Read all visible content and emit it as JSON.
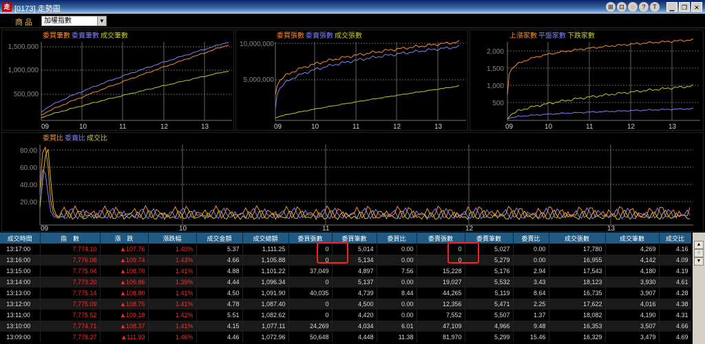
{
  "window": {
    "title": "[0173] 走勢圖",
    "app_icon": "app-logo-icon"
  },
  "title_tools": [
    "⊞",
    "⊡",
    "◌",
    "?",
    "T"
  ],
  "window_buttons": [
    "▁",
    "❐",
    "✕"
  ],
  "toolbar": {
    "product_label": "商 品",
    "product_value": "加權指數"
  },
  "charts": {
    "c1": {
      "legend": [
        "委買筆數",
        "委賣筆數",
        "成交筆數"
      ],
      "legend_colors": [
        "#ff8c28",
        "#8080ff",
        "#c8c828"
      ],
      "y_ticks": [
        "1,500,000",
        "1,000,000",
        "500,000"
      ],
      "x_ticks": [
        "09",
        "10",
        "11",
        "12",
        "13"
      ]
    },
    "c2": {
      "legend": [
        "委買張數",
        "委賣張數",
        "成交張數"
      ],
      "legend_colors": [
        "#ff8c28",
        "#8080ff",
        "#c8c828"
      ],
      "y_ticks": [
        "10,000,000",
        "5,000,000"
      ],
      "x_ticks": [
        "09",
        "10",
        "11",
        "12",
        "13"
      ]
    },
    "c3": {
      "legend": [
        "上漲家數",
        "平盤家數",
        "下跌家數"
      ],
      "legend_colors": [
        "#ff8c28",
        "#8080ff",
        "#c8c828"
      ],
      "y_ticks": [
        "2,000",
        "1,500",
        "1,000",
        "500"
      ],
      "x_ticks": [
        "09",
        "10",
        "11",
        "12",
        "13"
      ]
    },
    "c4": {
      "legend": [
        "委買比",
        "委賣比",
        "成交比"
      ],
      "legend_colors": [
        "#ff8c28",
        "#8080ff",
        "#c8c828"
      ],
      "y_ticks": [
        "80.00",
        "60.00",
        "40.00",
        "20.00"
      ],
      "x_ticks": [
        "09",
        "10",
        "11",
        "12",
        "13"
      ]
    }
  },
  "table": {
    "headers": [
      "成交時間",
      "指　數",
      "漲　跌",
      "漲跌幅",
      "成交金額",
      "成交總額",
      "委買張數",
      "委買筆數",
      "委買比",
      "委賣張數",
      "委賣筆數",
      "委賣比",
      "成交張數",
      "成交筆數",
      "成交比"
    ],
    "rows": [
      [
        "13:17:00",
        "7,774.10",
        "▲107.76",
        "1.40%",
        "5.37",
        "1,111.25",
        "0",
        "5,014",
        "0.00",
        "0",
        "5,027",
        "0.00",
        "17,780",
        "4,269",
        "4.16"
      ],
      [
        "13:16:00",
        "7,776.08",
        "▲109.74",
        "1.43%",
        "4.66",
        "1,105.88",
        "0",
        "5,134",
        "0.00",
        "0",
        "5,279",
        "0.00",
        "16,955",
        "4,142",
        "4.09"
      ],
      [
        "13:15:00",
        "7,775.04",
        "▲108.70",
        "1.41%",
        "4.88",
        "1,101.22",
        "37,049",
        "4,897",
        "7.56",
        "15,228",
        "5,176",
        "2.94",
        "17,543",
        "4,180",
        "4.19"
      ],
      [
        "13:14:00",
        "7,773.20",
        "▲106.86",
        "1.39%",
        "4.44",
        "1,096.34",
        "0",
        "5,137",
        "0.00",
        "19,027",
        "5,532",
        "3.43",
        "18,123",
        "3,930",
        "4.61"
      ],
      [
        "13:13:00",
        "7,775.14",
        "▲108.80",
        "1.41%",
        "4.50",
        "1,091.90",
        "40,035",
        "4,739",
        "8.44",
        "44,265",
        "5,119",
        "8.64",
        "16,735",
        "3,907",
        "4.28"
      ],
      [
        "13:12:00",
        "7,775.09",
        "▲108.75",
        "1.41%",
        "4.78",
        "1,087.40",
        "0",
        "4,500",
        "0.00",
        "12,356",
        "5,471",
        "2.25",
        "17,622",
        "4,016",
        "4.38"
      ],
      [
        "13:11:00",
        "7,775.52",
        "▲109.18",
        "1.42%",
        "5.51",
        "1,082.62",
        "0",
        "4,420",
        "0.00",
        "7,552",
        "5,507",
        "1.37",
        "18,082",
        "4,190",
        "4.31"
      ],
      [
        "13:10:00",
        "7,774.71",
        "▲108.37",
        "1.41%",
        "4.15",
        "1,077.11",
        "24,269",
        "4,034",
        "6.01",
        "47,109",
        "4,966",
        "9.48",
        "16,353",
        "3,507",
        "4.66"
      ],
      [
        "13:09:00",
        "7,778.27",
        "▲111.93",
        "1.46%",
        "4.46",
        "1,072.96",
        "50,648",
        "4,448",
        "11.38",
        "81,970",
        "5,299",
        "15.46",
        "16,329",
        "3,479",
        "4.69"
      ]
    ]
  },
  "scrollbar": {
    "up": "▲",
    "mid": "○",
    "down": "▼"
  }
}
